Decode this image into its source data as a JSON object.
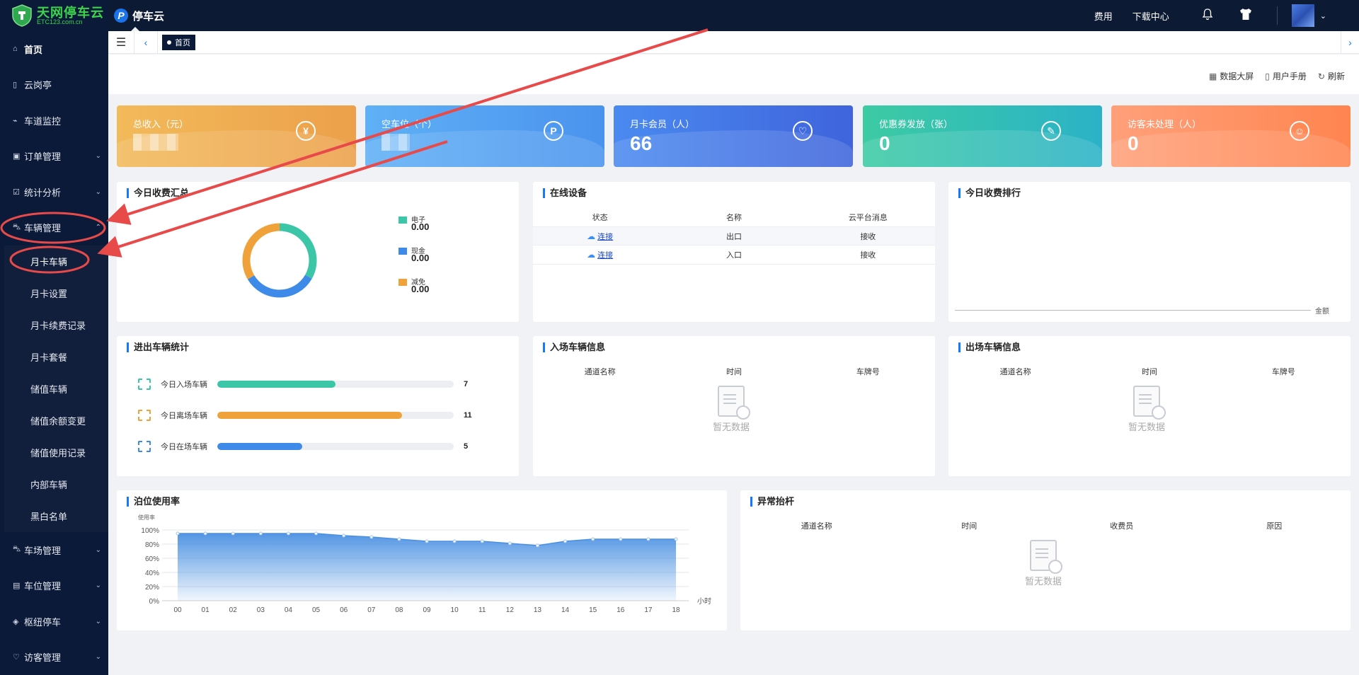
{
  "logo": {
    "main": "天网停车云",
    "sub": "ETC123.com.cn"
  },
  "brand": {
    "name": "停车云"
  },
  "topbar": {
    "fees": "费用",
    "download": "下载中心"
  },
  "sidebar": {
    "items": [
      {
        "label": "首页",
        "icon": "home-icon"
      },
      {
        "label": "云岗亭",
        "icon": "booth-icon"
      },
      {
        "label": "车道监控",
        "icon": "monitor-icon"
      },
      {
        "label": "订单管理",
        "icon": "order-icon"
      },
      {
        "label": "统计分析",
        "icon": "stats-icon"
      },
      {
        "label": "车辆管理",
        "icon": "vehicle-icon"
      }
    ],
    "submenu": [
      "月卡车辆",
      "月卡设置",
      "月卡续费记录",
      "月卡套餐",
      "储值车辆",
      "储值余额变更",
      "储值使用记录",
      "内部车辆",
      "黑白名单"
    ],
    "items_after": [
      {
        "label": "车场管理",
        "icon": "lot-icon"
      },
      {
        "label": "车位管理",
        "icon": "space-icon"
      },
      {
        "label": "枢纽停车",
        "icon": "hub-icon"
      },
      {
        "label": "访客管理",
        "icon": "visitor-icon"
      }
    ]
  },
  "tabs": {
    "active": "首页"
  },
  "toolbar": {
    "bigscreen": "数据大屏",
    "manual": "用户手册",
    "refresh": "刷新"
  },
  "stats": [
    {
      "label": "总收入（元）",
      "value": "",
      "icon": "¥",
      "color": "#f0a23a"
    },
    {
      "label": "空车位（个）",
      "value": "",
      "icon": "P",
      "color": "#4a9bf0"
    },
    {
      "label": "月卡会员（人）",
      "value": "66",
      "icon": "♡",
      "color": "#3f6de0"
    },
    {
      "label": "优惠券发放（张）",
      "value": "0",
      "icon": "✎",
      "color": "#2fc3b0"
    },
    {
      "label": "访客未处理（人）",
      "value": "0",
      "icon": "☺",
      "color": "#ff8a5c"
    }
  ],
  "revenue": {
    "title": "今日收费汇总",
    "legend": [
      {
        "name": "电子",
        "value": "0.00",
        "color": "#3cc6a8"
      },
      {
        "name": "现金",
        "value": "0.00",
        "color": "#3d8ae8"
      },
      {
        "name": "减免",
        "value": "0.00",
        "color": "#f0a23a"
      }
    ]
  },
  "devices": {
    "title": "在线设备",
    "headers": [
      "状态",
      "名称",
      "云平台消息"
    ],
    "rows": [
      {
        "status": "连接",
        "name": "出口",
        "msg": "接收"
      },
      {
        "status": "连接",
        "name": "入口",
        "msg": "接收"
      }
    ]
  },
  "ranking": {
    "title": "今日收费排行",
    "axis_label": "金额"
  },
  "flow": {
    "title": "进出车辆统计",
    "rows": [
      {
        "label": "今日入场车辆",
        "value": "7",
        "fraction": 0.5,
        "color": "#3cc6a8"
      },
      {
        "label": "今日离场车辆",
        "value": "11",
        "fraction": 0.78,
        "color": "#f0a23a"
      },
      {
        "label": "今日在场车辆",
        "value": "5",
        "fraction": 0.36,
        "color": "#3d8ae8"
      }
    ]
  },
  "entry": {
    "title": "入场车辆信息",
    "headers": [
      "通道名称",
      "时间",
      "车牌号"
    ],
    "empty": "暂无数据"
  },
  "exit": {
    "title": "出场车辆信息",
    "headers": [
      "通道名称",
      "时间",
      "车牌号"
    ],
    "empty": "暂无数据"
  },
  "occupancy": {
    "title": "泊位使用率"
  },
  "abnormal": {
    "title": "异常抬杆",
    "headers": [
      "通道名称",
      "时间",
      "收费员",
      "原因"
    ],
    "empty": "暂无数据"
  },
  "chart_data": {
    "type": "area",
    "ylabel": "使用率",
    "xlabel": "小时",
    "x": [
      "00",
      "01",
      "02",
      "03",
      "04",
      "05",
      "06",
      "07",
      "08",
      "09",
      "10",
      "11",
      "12",
      "13",
      "14",
      "15",
      "16",
      "17",
      "18"
    ],
    "yticks": [
      "0%",
      "20%",
      "40%",
      "60%",
      "80%",
      "100%"
    ],
    "ylim": [
      0,
      100
    ],
    "series": [
      {
        "values": [
          95,
          95,
          95,
          95,
          95,
          95,
          92,
          90,
          87,
          84,
          84,
          84,
          81,
          78,
          84,
          87,
          87,
          87,
          87
        ]
      }
    ],
    "color": "#4a90e2"
  }
}
